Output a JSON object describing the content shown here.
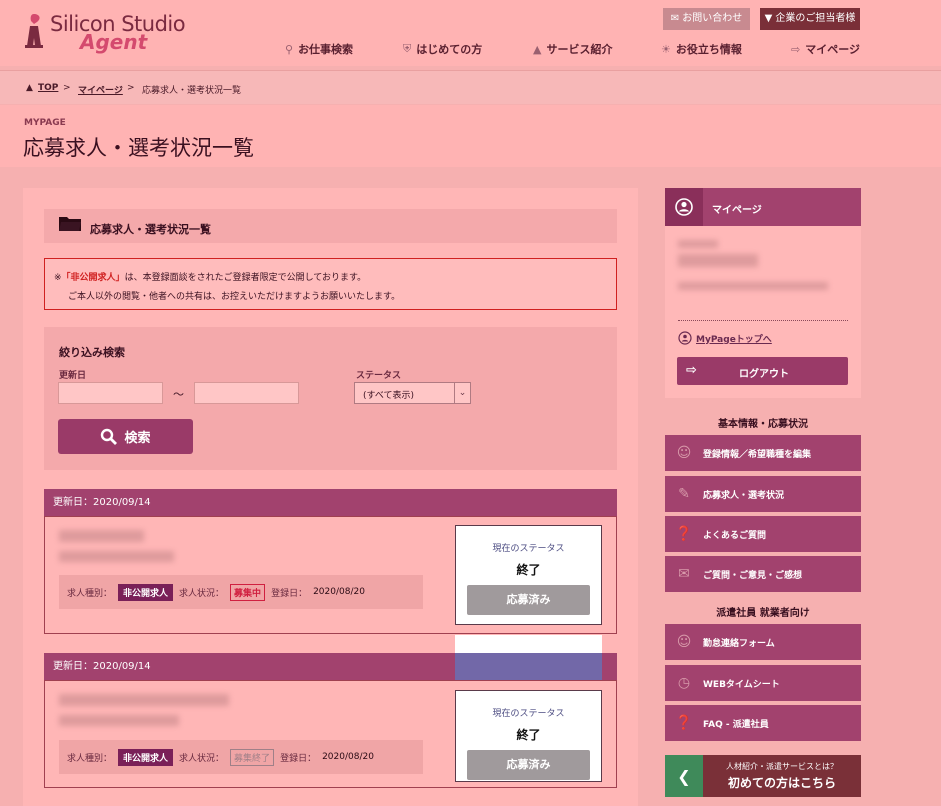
{
  "header": {
    "logo_line1": "Silicon Studio",
    "logo_line2": "Agent",
    "contact_label": "お問い合わせ",
    "corporate_label": "▼ 企業のご担当者様",
    "nav": [
      {
        "label": "お仕事検索",
        "icon": "search-icon"
      },
      {
        "label": "はじめての方",
        "icon": "shield-icon"
      },
      {
        "label": "サービス紹介",
        "icon": "logo-icon"
      },
      {
        "label": "お役立ち情報",
        "icon": "bulb-icon"
      },
      {
        "label": "マイページ",
        "icon": "login-icon"
      }
    ]
  },
  "breadcrumb": {
    "top": "TOP",
    "mypage": "マイページ",
    "current": "応募求人・選考状況一覧",
    "sep": ">"
  },
  "page": {
    "subtitle": "MYPAGE",
    "title": "応募求人・選考状況一覧"
  },
  "section": {
    "title": "応募求人・選考状況一覧"
  },
  "notice": {
    "mark": "※",
    "highlight": "「非公開求人」",
    "line1_rest": "は、本登録面談をされたご登録者限定で公開しております。",
    "line2": "ご本人以外の閲覧・他者への共有は、お控えいただけますようお願いいたします。"
  },
  "filter": {
    "title": "絞り込み検索",
    "date_label": "更新日",
    "tilde": "～",
    "status_label": "ステータス",
    "status_value": "(すべて表示)",
    "search_label": "検索"
  },
  "cards": [
    {
      "updated": "更新日：2020/09/14",
      "type_label": "求人種別：",
      "type_value": "非公開求人",
      "state_label": "求人状況：",
      "state_value": "募集中",
      "reg_label": "登録日：",
      "reg_value": "2020/08/20",
      "status_label": "現在のステータス",
      "status_value": "終了",
      "status_button": "応募済み"
    },
    {
      "updated": "更新日：2020/09/14",
      "type_label": "求人種別：",
      "type_value": "非公開求人",
      "state_label": "求人状況：",
      "state_value": "募集終了",
      "reg_label": "登録日：",
      "reg_value": "2020/08/20",
      "status_label": "現在のステータス",
      "status_value": "終了",
      "status_button": "応募済み"
    }
  ],
  "sidebar": {
    "mypage_title": "マイページ",
    "mypage_link": "MyPageトップへ",
    "logout_label": "ログアウト",
    "group1_title": "基本情報・応募状況",
    "group1": [
      {
        "label": "登録情報／希望職種を編集",
        "icon": "user-info-icon"
      },
      {
        "label": "応募求人・選考状況",
        "icon": "document-icon"
      },
      {
        "label": "よくあるご質問",
        "icon": "question-bubble-icon"
      },
      {
        "label": "ご質問・ご意見・ご感想",
        "icon": "chat-bubbles-icon"
      }
    ],
    "group2_title": "派遣社員 就業者向け",
    "group2": [
      {
        "label": "勤怠連絡フォーム",
        "icon": "user-clock-icon"
      },
      {
        "label": "WEBタイムシート",
        "icon": "clock-icon"
      },
      {
        "label": "FAQ - 派遣社員",
        "icon": "question-bubble-icon"
      }
    ],
    "banner_line1": "人材紹介・派遣サービスとは？",
    "banner_line2": "初めての方はこちら"
  },
  "colors": {
    "accent": "#a2426e",
    "header_bg": "#ffb3b3",
    "badge_red": "#d02040"
  }
}
